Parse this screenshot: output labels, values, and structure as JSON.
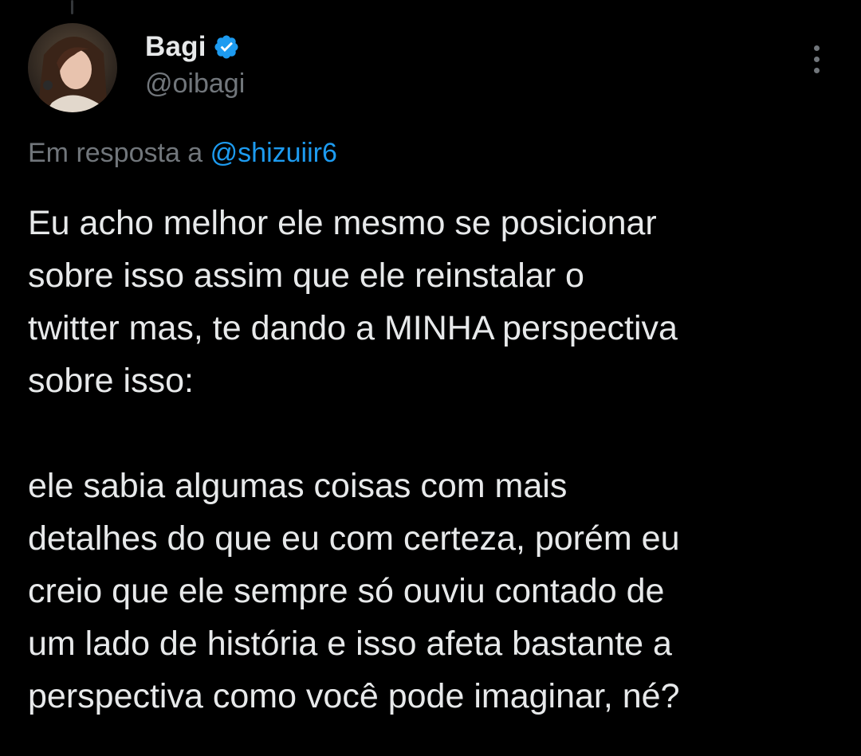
{
  "author": {
    "display_name": "Bagi",
    "handle": "@oibagi",
    "verified": true,
    "verified_color": "#1d9bf0"
  },
  "reply": {
    "prefix": "Em resposta a",
    "mention": "@shizuiir6"
  },
  "tweet": {
    "paragraph_1": "Eu acho melhor ele mesmo se posicionar\nsobre isso assim que ele reinstalar o\ntwitter mas, te dando a MINHA perspectiva\nsobre isso:",
    "paragraph_2": "ele sabia algumas coisas com mais\ndetalhes do que eu com certeza, porém eu\ncreio que ele sempre só ouviu contado de\num lado de história e isso afeta bastante a\nperspectiva como você pode imaginar, né?"
  },
  "icons": {
    "more": "more-vertical-icon",
    "verified": "verified-badge-icon"
  },
  "colors": {
    "background": "#000000",
    "text": "#e7e9ea",
    "secondary": "#71767b",
    "accent": "#1d9bf0"
  }
}
